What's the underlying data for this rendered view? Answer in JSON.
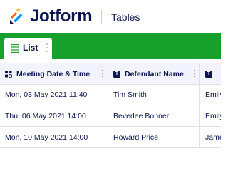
{
  "header": {
    "brand": "Jotform",
    "product": "Tables",
    "colors": {
      "brand_blue": "#0a1551",
      "logo_orange": "#ff6100",
      "logo_blue": "#0099ff",
      "logo_yellow": "#ffb629"
    }
  },
  "tabbar": {
    "background": "#18a02d",
    "tabs": [
      {
        "label": "List",
        "icon": "grid-table-icon"
      }
    ]
  },
  "table": {
    "columns": [
      {
        "label": "Meeting Date & Time",
        "icon": "date-time-icon"
      },
      {
        "label": "Defendant Name",
        "icon": "text-field-icon"
      },
      {
        "label": "",
        "icon": "text-field-icon"
      }
    ],
    "rows": [
      [
        "Mon, 03 May 2021 11:40",
        "Tim Smith",
        "Emily"
      ],
      [
        "Thu, 06 May 2021 14:00",
        "Beverlee Bonner",
        "Emily"
      ],
      [
        "Mon, 10 May 2021 14:00",
        "Howard Price",
        "James"
      ]
    ]
  }
}
